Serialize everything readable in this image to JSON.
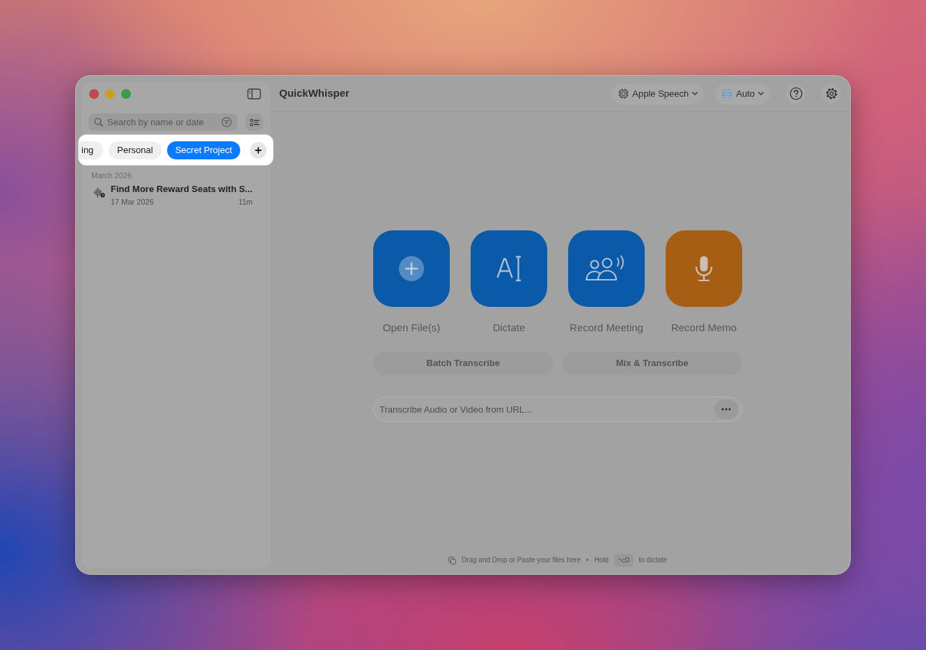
{
  "window": {
    "title": "QuickWhisper"
  },
  "sidebar": {
    "search": {
      "placeholder": "Search by name or date"
    },
    "tag_bar": {
      "spotlight": true,
      "tags": [
        {
          "label": "ing",
          "selected": false
        },
        {
          "label": "Personal",
          "selected": false
        },
        {
          "label": "Secret Project",
          "selected": true
        }
      ]
    },
    "sections": [
      {
        "heading": "March 2026",
        "items": [
          {
            "title": "Find More Reward Seats with S...",
            "date": "17 Mar 2026",
            "duration": "11m"
          }
        ]
      }
    ]
  },
  "toolbar": {
    "engine": "Apple Speech",
    "language": "Auto"
  },
  "actions": [
    {
      "kind": "open",
      "label": "Open File(s)",
      "color": "#0b59a9"
    },
    {
      "kind": "dictate",
      "label": "Dictate",
      "color": "#0b59a9"
    },
    {
      "kind": "meeting",
      "label": "Record Meeting",
      "color": "#0b59a9"
    },
    {
      "kind": "memo",
      "label": "Record Memo",
      "color": "#a65d14"
    }
  ],
  "secondary_actions": [
    "Batch Transcribe",
    "Mix & Transcribe"
  ],
  "url_field": {
    "placeholder": "Transcribe Audio or Video from URL..."
  },
  "footer": {
    "hint": "Drag and Drop or Paste your files here",
    "separator": "•",
    "hold": "Hold",
    "shortcut": "⌥D",
    "suffix": "to dictate"
  }
}
